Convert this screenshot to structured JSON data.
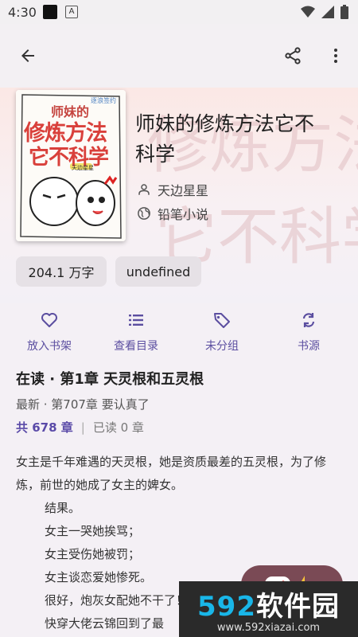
{
  "status": {
    "time": "4:30"
  },
  "book": {
    "title": "师妹的修炼方法它不科学",
    "author": "天边星星",
    "source": "铅笔小说",
    "cover_title_top": "师妹的",
    "cover_title_mid": "修炼方法",
    "cover_title_bottom": "它不科学",
    "cover_author": "天边星星",
    "cover_logo": "逐浪签约",
    "background_text_1": "修炼方法",
    "background_text_2": "它不科学"
  },
  "chips": {
    "word_count": "204.1 万字",
    "category": "undefined"
  },
  "actions": [
    {
      "label": "放入书架",
      "icon": "heart-icon"
    },
    {
      "label": "查看目录",
      "icon": "list-icon"
    },
    {
      "label": "未分组",
      "icon": "tag-icon"
    },
    {
      "label": "书源",
      "icon": "swap-icon"
    }
  ],
  "progress": {
    "reading": "在读 · 第1章 天灵根和五灵根",
    "latest": "最新 · 第707章 要认真了",
    "total": "共 678 章",
    "separator": "|",
    "read": "已读 0 章"
  },
  "intro": [
    "女主是千年难遇的天灵根，她是资质最差的五灵根，为了修炼，前世的她成了女主的婢女。",
    "结果。",
    "女主一哭她挨骂；",
    "女主受伤她被罚；",
    "女主谈恋爱她惨死。",
    "很好，炮灰女配她不干了！",
    "快穿大佬云锦回到了最"
  ],
  "watermark": {
    "brand_num": "592",
    "brand_text": "软件园",
    "url": "www.592xiazai.com"
  },
  "colors": {
    "accent": "#5b4ea0",
    "chip_bg": "#e6e1e6",
    "watermark_blue": "#19b6e8"
  }
}
